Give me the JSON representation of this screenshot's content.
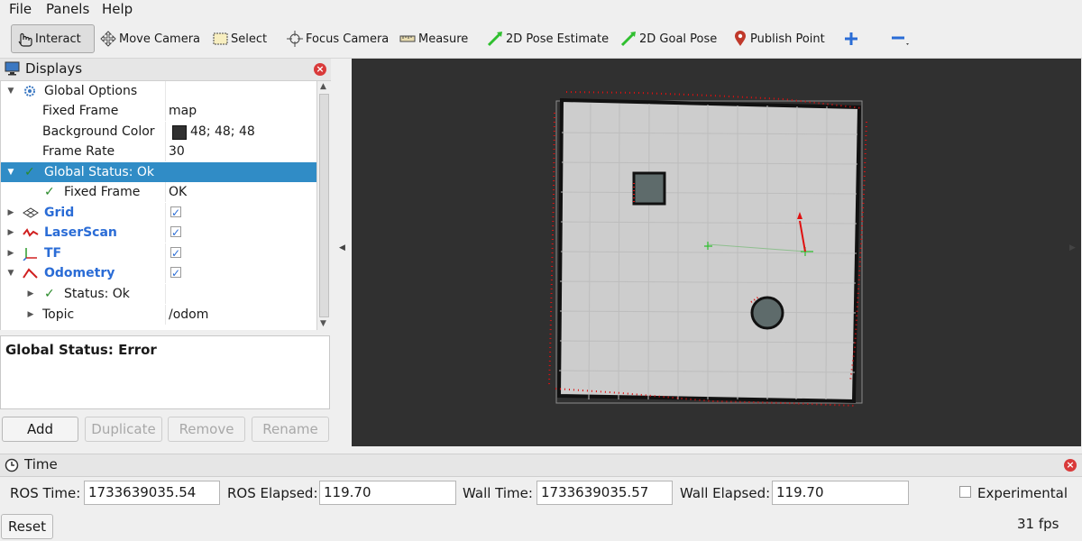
{
  "menu": [
    "File",
    "Panels",
    "Help"
  ],
  "toolbar": {
    "interact": "Interact",
    "move_camera": "Move Camera",
    "select": "Select",
    "focus_camera": "Focus Camera",
    "measure": "Measure",
    "pose_estimate": "2D Pose Estimate",
    "goal_pose": "2D Goal Pose",
    "publish_point": "Publish Point"
  },
  "displays": {
    "title": "Displays",
    "rows": [
      {
        "label": "Global Options",
        "value": ""
      },
      {
        "label": "Fixed Frame",
        "value": "map"
      },
      {
        "label": "Background Color",
        "value": "48; 48; 48",
        "color": "#303030"
      },
      {
        "label": "Frame Rate",
        "value": "30"
      },
      {
        "label": "Global Status: Ok",
        "value": ""
      },
      {
        "label": "Fixed Frame",
        "value": "OK"
      },
      {
        "label": "Grid",
        "checked": true
      },
      {
        "label": "LaserScan",
        "checked": true
      },
      {
        "label": "TF",
        "checked": true
      },
      {
        "label": "Odometry",
        "checked": true
      },
      {
        "label": "Status: Ok",
        "value": ""
      },
      {
        "label": "Topic",
        "value": "/odom"
      }
    ],
    "status_text": "Global Status: Error",
    "buttons": {
      "add": "Add",
      "duplicate": "Duplicate",
      "remove": "Remove",
      "rename": "Rename"
    }
  },
  "time": {
    "title": "Time",
    "ros_time_label": "ROS Time:",
    "ros_time": "1733639035.54",
    "ros_elapsed_label": "ROS Elapsed:",
    "ros_elapsed": "119.70",
    "wall_time_label": "Wall Time:",
    "wall_time": "1733639035.57",
    "wall_elapsed_label": "Wall Elapsed:",
    "wall_elapsed": "119.70",
    "experimental": "Experimental",
    "reset": "Reset",
    "fps": "31 fps"
  },
  "colors": {
    "viewport_bg": "#303030",
    "selection": "#308cc6",
    "accent_blue": "#2a6cd6",
    "laser_red": "#e01010"
  }
}
